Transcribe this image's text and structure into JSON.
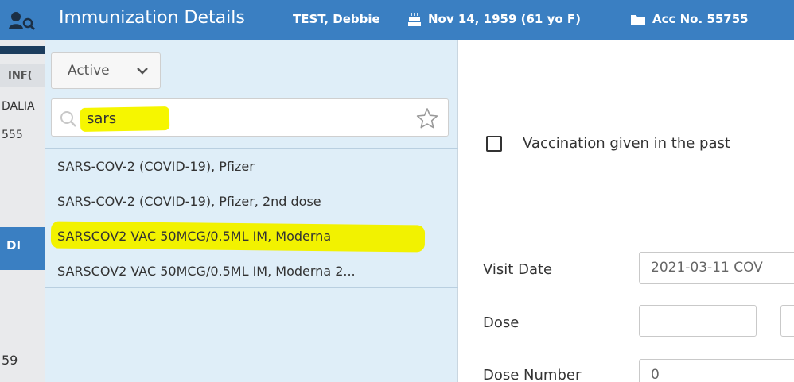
{
  "titlebar": {
    "title": "Immunization Details",
    "patient_name": "TEST, Debbie",
    "dob": "Nov 14, 1959 (61 yo F)",
    "account": "Acc No. 55755",
    "icons": {
      "app": "patient-search-icon",
      "dob": "birthday-cake-icon",
      "account": "folder-icon"
    }
  },
  "background_window": {
    "header_text": "INF(",
    "text_1": "DALIA",
    "text_2": "555",
    "tab_text": "DI",
    "text_3": "59"
  },
  "left_panel": {
    "status_filter": {
      "selected": "Active"
    },
    "search": {
      "value": "sars"
    },
    "results": [
      {
        "label": "SARS-COV-2 (COVID-19), Pfizer",
        "highlighted": false
      },
      {
        "label": "SARS-COV-2 (COVID-19), Pfizer, 2nd dose",
        "highlighted": false
      },
      {
        "label": "SARSCOV2 VAC 50MCG/0.5ML IM, Moderna",
        "highlighted": true
      },
      {
        "label": "SARSCOV2 VAC 50MCG/0.5ML IM, Moderna 2...",
        "highlighted": false
      }
    ]
  },
  "form": {
    "past_vaccination_label": "Vaccination given in the past",
    "visit_date_label": "Visit Date",
    "visit_date_value": "2021-03-11 COV",
    "dose_label": "Dose",
    "dose_value": "",
    "dose_number_label": "Dose Number",
    "dose_number_value": "0"
  },
  "colors": {
    "titlebar": "#3a7fc2",
    "panel": "#dfeef8",
    "highlight": "#f6f600"
  }
}
